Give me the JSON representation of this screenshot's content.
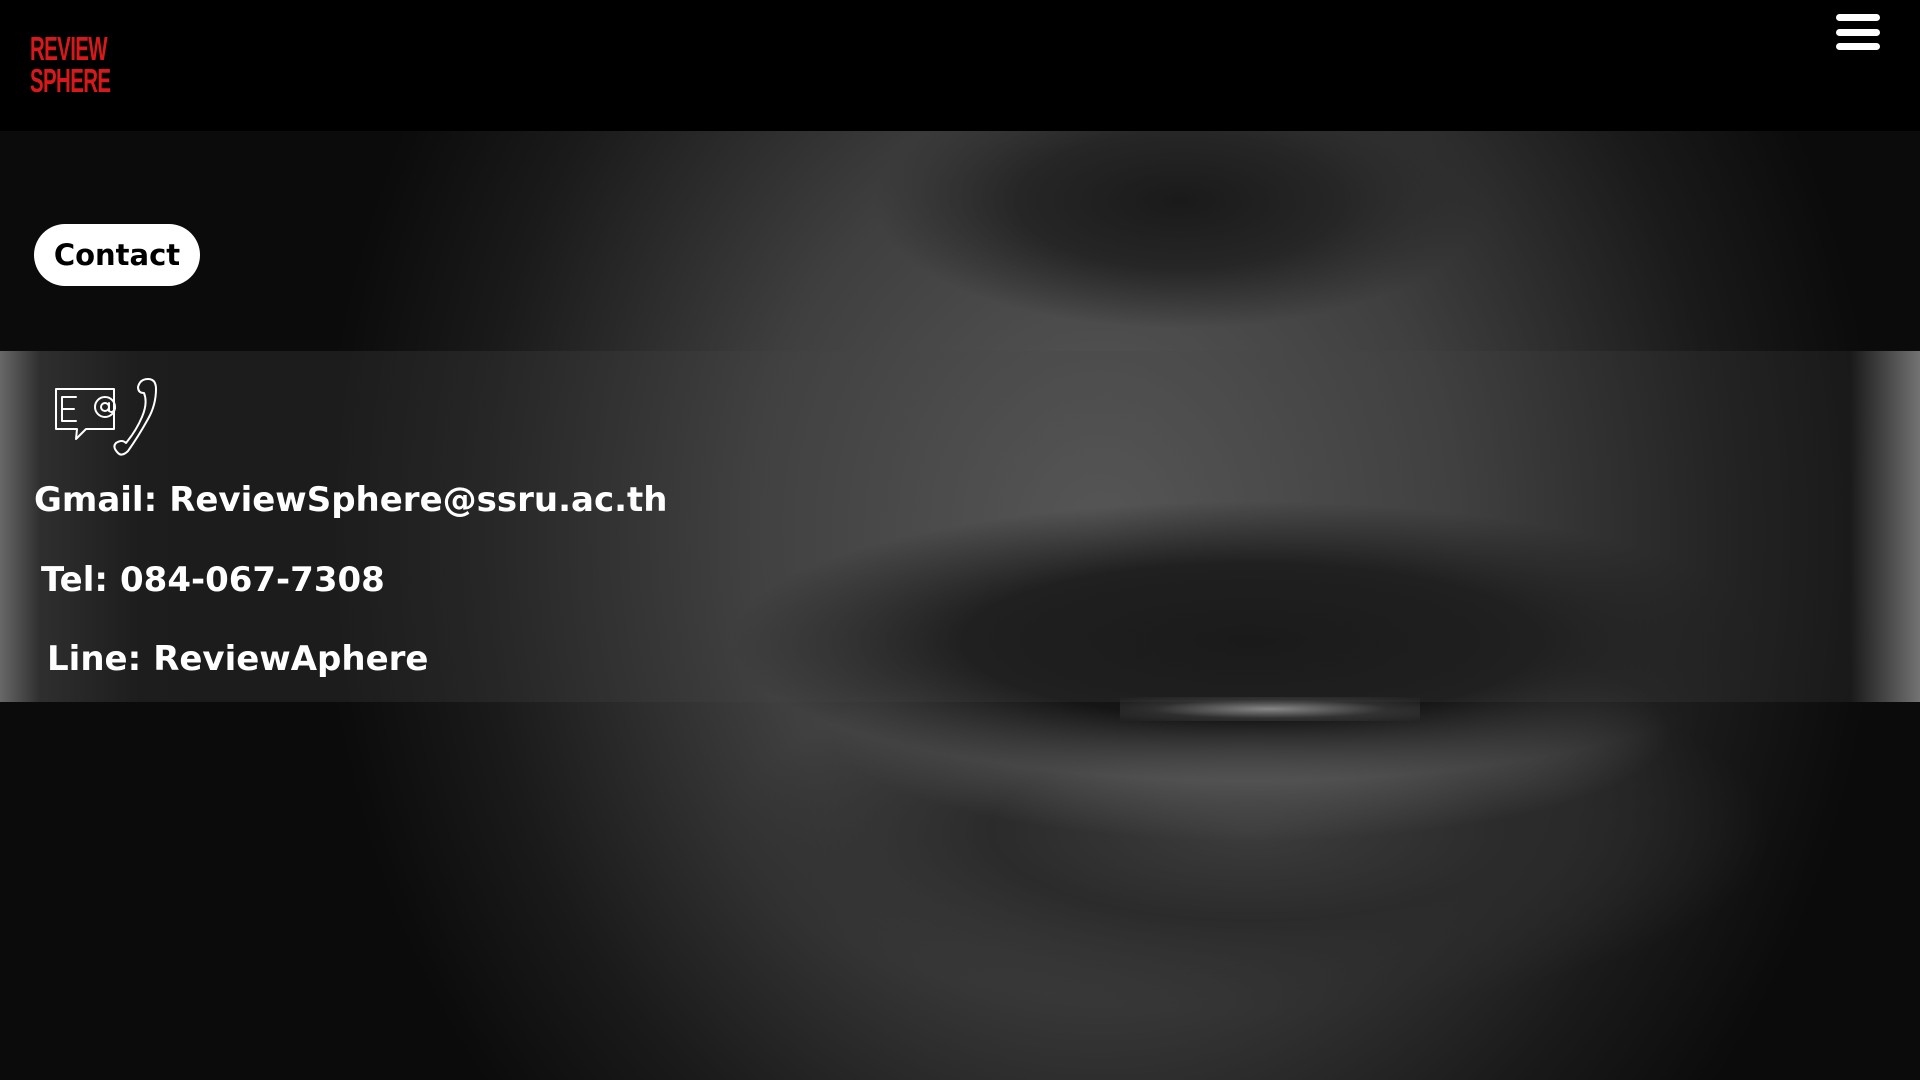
{
  "header": {
    "logo_line1": "REVIEW",
    "logo_line2": "SPHERE",
    "menu_icon": "hamburger-menu-icon",
    "brand_color": "#d7191b"
  },
  "main": {
    "section_button": "Contact",
    "contact_icon": "email-phone-icon",
    "contacts": [
      {
        "label": "Gmail:",
        "value": "ReviewSphere@ssru.ac.th"
      },
      {
        "label": "Tel:",
        "value": "084-067-7308"
      },
      {
        "label": "Line:",
        "value": "ReviewAphere"
      }
    ]
  }
}
